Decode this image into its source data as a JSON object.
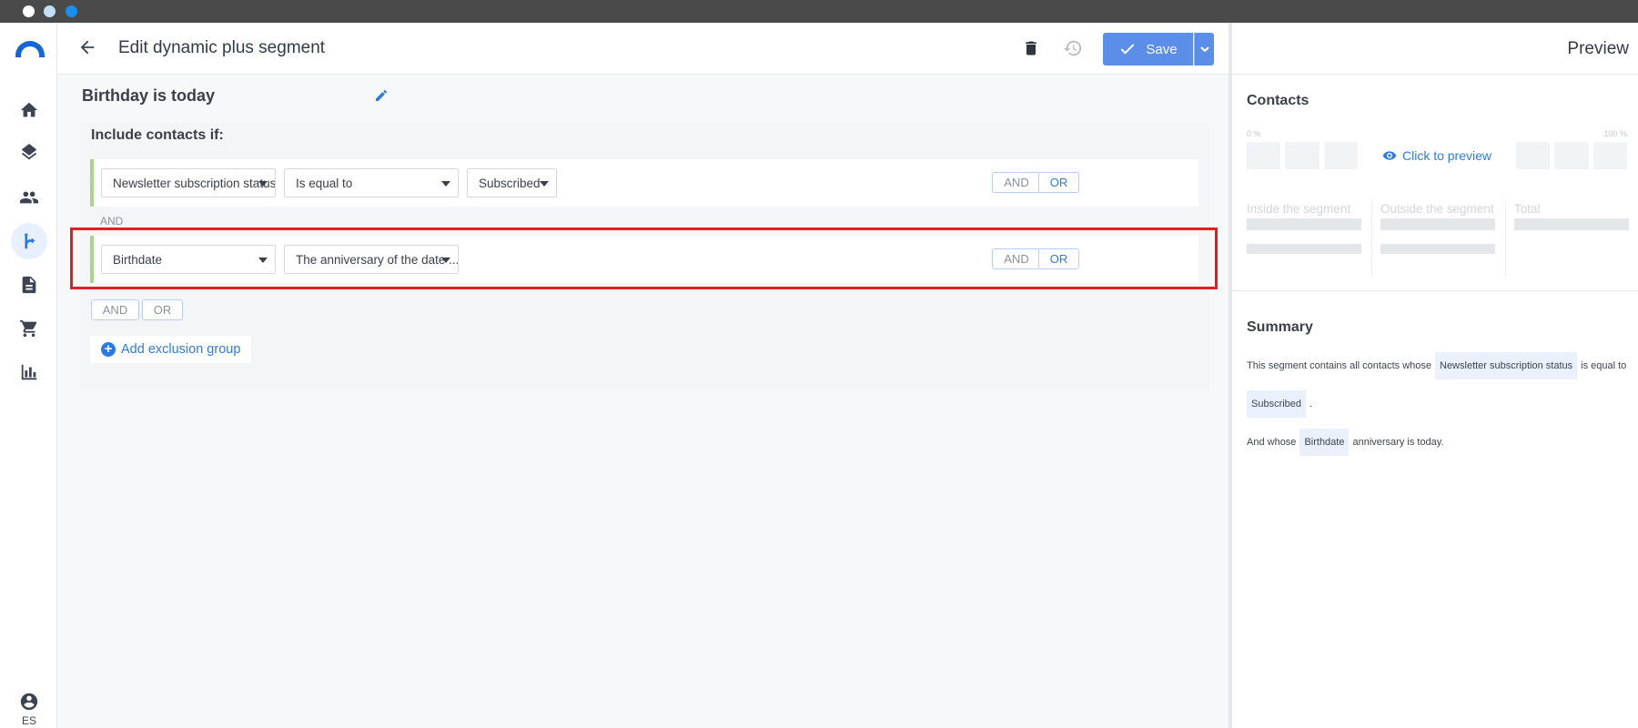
{
  "window": {
    "dots": [
      "close",
      "minimize",
      "maximize"
    ]
  },
  "nav": {
    "items": [
      {
        "icon": "home-icon"
      },
      {
        "icon": "layers-icon"
      },
      {
        "icon": "contacts-icon"
      },
      {
        "icon": "segments-icon",
        "active": true
      },
      {
        "icon": "document-icon"
      },
      {
        "icon": "cart-icon"
      },
      {
        "icon": "reports-icon"
      }
    ],
    "user_lang": "ES"
  },
  "header": {
    "title": "Edit dynamic plus segment",
    "save_label": "Save"
  },
  "segment": {
    "name": "Birthday is today",
    "include_label": "Include contacts if:",
    "rules": [
      {
        "field": "Newsletter subscription status",
        "operator": "Is equal to",
        "value": "Subscribed",
        "and_label": "AND",
        "or_label": "OR"
      },
      {
        "field": "Birthdate",
        "operator": "The anniversary of the date ...",
        "and_label": "AND",
        "or_label": "OR"
      }
    ],
    "connector": "AND",
    "group_and": "AND",
    "group_or": "OR",
    "add_exclusion": "Add exclusion group"
  },
  "preview": {
    "title": "Preview",
    "contacts_heading": "Contacts",
    "pct_min": "0 %",
    "pct_max": "100 %",
    "click_to_preview": "Click to preview",
    "inside_label": "Inside the segment",
    "outside_label": "Outside the segment",
    "total_label": "Total",
    "summary_heading": "Summary",
    "summary": {
      "l1_prefix": "This segment contains all contacts whose",
      "l1_chip": "Newsletter subscription status",
      "l1_suffix": "is equal to",
      "l2_chip": "Subscribed",
      "l2_suffix": ".",
      "l3_prefix": "And whose",
      "l3_chip": "Birthdate",
      "l3_suffix": "anniversary is today."
    }
  },
  "colors": {
    "accent": "#2c7be5",
    "save": "#5b8ee8",
    "rule_bar": "#a7d68a",
    "highlight": "#e02020"
  }
}
